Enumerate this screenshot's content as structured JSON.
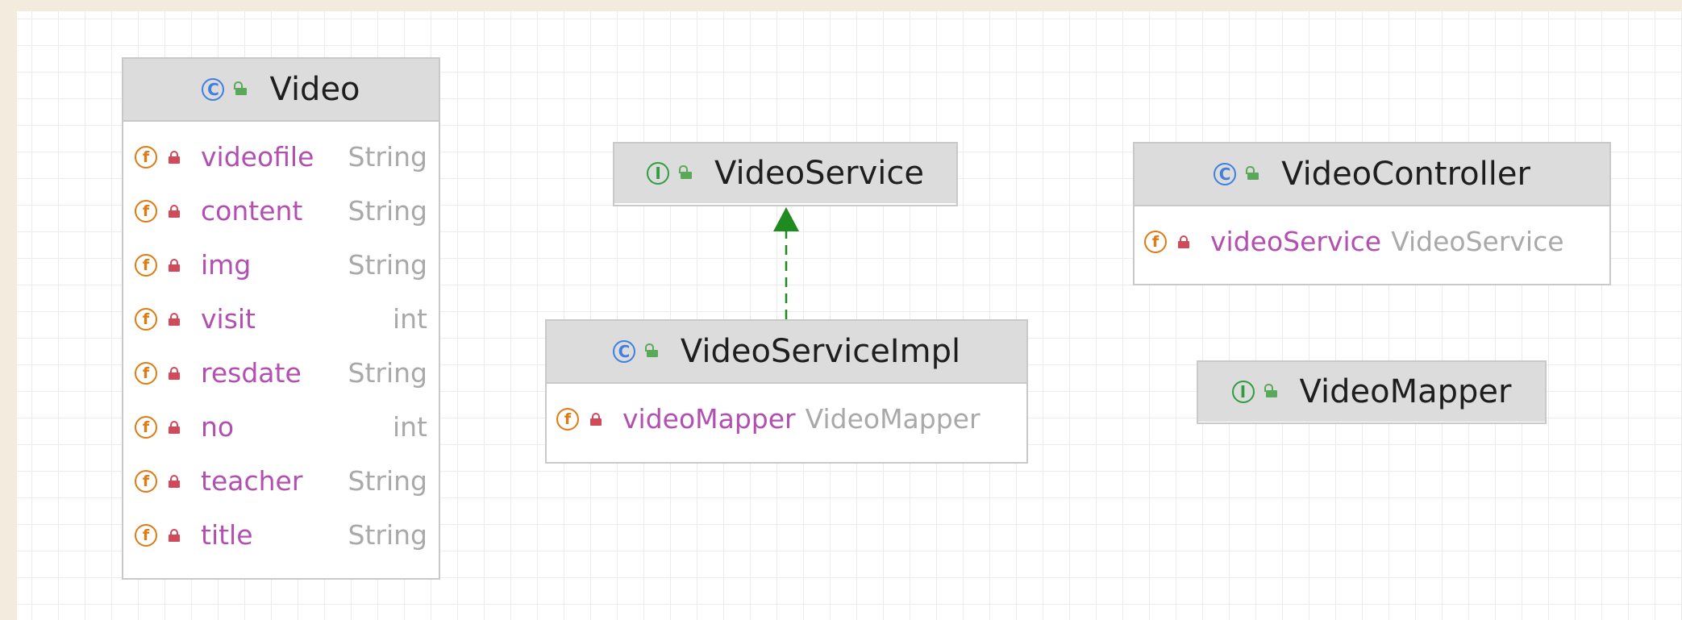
{
  "nodes": {
    "video": {
      "kind": "class",
      "name": "Video",
      "fields": [
        {
          "name": "videofile",
          "type": "String"
        },
        {
          "name": "content",
          "type": "String"
        },
        {
          "name": "img",
          "type": "String"
        },
        {
          "name": "visit",
          "type": "int"
        },
        {
          "name": "resdate",
          "type": "String"
        },
        {
          "name": "no",
          "type": "int"
        },
        {
          "name": "teacher",
          "type": "String"
        },
        {
          "name": "title",
          "type": "String"
        }
      ]
    },
    "video_service": {
      "kind": "interface",
      "name": "VideoService"
    },
    "video_service_impl": {
      "kind": "class",
      "name": "VideoServiceImpl",
      "fields": [
        {
          "name": "videoMapper",
          "type": "VideoMapper"
        }
      ]
    },
    "video_controller": {
      "kind": "class",
      "name": "VideoController",
      "fields": [
        {
          "name": "videoService",
          "type": "VideoService"
        }
      ]
    },
    "video_mapper": {
      "kind": "interface",
      "name": "VideoMapper"
    }
  },
  "edges": [
    {
      "from": "VideoServiceImpl",
      "to": "VideoService",
      "type": "implements",
      "style": "dashed",
      "color": "#1f8a1f"
    }
  ],
  "icons": {
    "class_letter": "C",
    "interface_letter": "I",
    "field_letter": "f"
  },
  "colors": {
    "class_icon": "#3f7fe0",
    "interface_icon": "#2f9e3f",
    "field_icon": "#e07a12",
    "field_name": "#b24fb0",
    "field_type": "#a9a9a9",
    "private_lock": "#d04a5a",
    "public_lock": "#5aa85a"
  }
}
